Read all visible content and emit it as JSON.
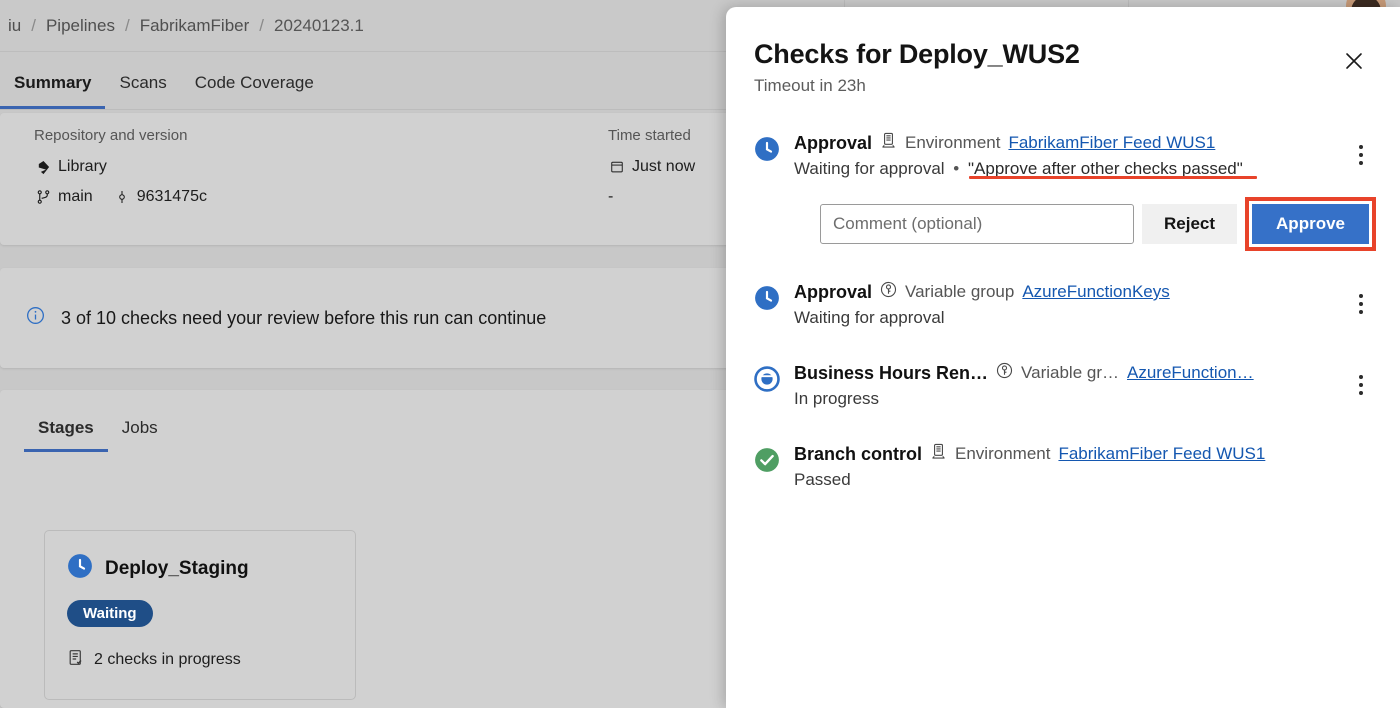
{
  "background": {
    "breadcrumb": {
      "items": [
        "iu",
        "Pipelines",
        "FabrikamFiber",
        "20240123.1"
      ],
      "separator": "/"
    },
    "tabs": [
      {
        "label": "Summary",
        "active": true
      },
      {
        "label": "Scans",
        "active": false
      },
      {
        "label": "Code Coverage",
        "active": false
      }
    ],
    "summary": {
      "repo_label": "Repository and version",
      "repo_name": "Library",
      "repo_icon": "azure-repos-icon",
      "branch_name": "main",
      "branch_icon": "branch-icon",
      "commit_id": "9631475c",
      "commit_icon": "commit-icon",
      "time_label": "Time started",
      "time_value": "Just now",
      "time_icon": "calendar-icon",
      "elapsed_value": "-"
    },
    "banner": {
      "icon": "info-icon",
      "text": "3 of 10 checks need your review before this run can continue"
    },
    "stages_section": {
      "tabs": [
        {
          "label": "Stages",
          "active": true
        },
        {
          "label": "Jobs",
          "active": false
        }
      ],
      "stage_card": {
        "status_icon": "clock-icon",
        "name": "Deploy_Staging",
        "badge": "Waiting",
        "checks_icon": "checklist-icon",
        "checks_text": "2 checks in progress"
      }
    }
  },
  "panel": {
    "title": "Checks for Deploy_WUS2",
    "subtitle": "Timeout in 23h",
    "close_icon": "close-icon",
    "kebab_icon": "more-vertical-icon",
    "checks": [
      {
        "status_icon": "clock-icon",
        "name": "Approval",
        "resource_icon": "environment-icon",
        "resource_type": "Environment",
        "resource_link": "FabrikamFiber Feed WUS1",
        "state": "Waiting for approval",
        "separator": "•",
        "instruction": "\"Approve after other checks passed\"",
        "has_actions": true,
        "has_kebab": true
      },
      {
        "status_icon": "clock-icon",
        "name": "Approval",
        "resource_icon": "variable-group-icon",
        "resource_type": "Variable group",
        "resource_link": "AzureFunctionKeys",
        "state": "Waiting for approval",
        "has_actions": false,
        "has_kebab": true
      },
      {
        "status_icon": "in-progress-icon",
        "name": "Business Hours Ren…",
        "resource_icon": "variable-group-icon",
        "resource_type": "Variable gr…",
        "resource_link": "AzureFunction…",
        "state": "In progress",
        "has_actions": false,
        "has_kebab": true
      },
      {
        "status_icon": "success-check-icon",
        "name": "Branch control",
        "resource_icon": "environment-icon",
        "resource_type": "Environment",
        "resource_link": "FabrikamFiber Feed WUS1",
        "state": "Passed",
        "has_actions": false,
        "has_kebab": false
      }
    ],
    "approval_actions": {
      "comment_placeholder": "Comment (optional)",
      "comment_value": "",
      "reject_label": "Reject",
      "approve_label": "Approve"
    }
  },
  "colors": {
    "accent_blue": "#3671c8",
    "link_blue": "#1457b0",
    "highlight_red": "#e8432a",
    "success_green": "#4f9e63",
    "badge_blue": "#1f4e87",
    "page_bg": "#c8c8c8",
    "panel_bg": "#ffffff"
  }
}
